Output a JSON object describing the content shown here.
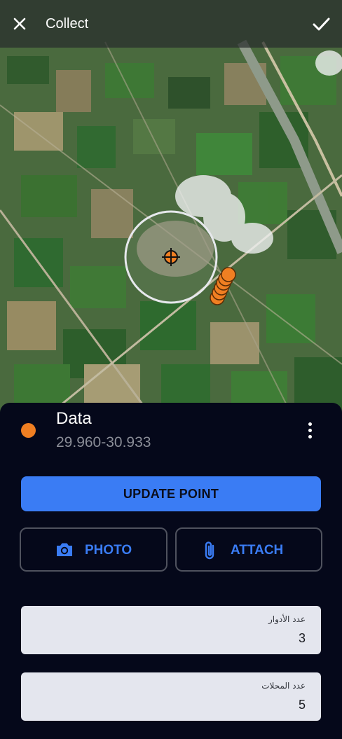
{
  "header": {
    "title": "Collect",
    "close_icon": "close-icon",
    "confirm_icon": "check-icon"
  },
  "map": {
    "marker_color": "#f07f22",
    "crosshair_icon": "crosshair-icon"
  },
  "layer": {
    "name": "Data",
    "subtitle": "29.960-30.933",
    "color": "#f07f22",
    "menu_icon": "more-vertical-icon"
  },
  "actions": {
    "update_label": "UPDATE POINT",
    "photo_label": "PHOTO",
    "photo_icon": "camera-icon",
    "attach_label": "ATTACH",
    "attach_icon": "paperclip-icon",
    "accent": "#3a7cf4"
  },
  "fields": [
    {
      "label": "عدد الأدوار",
      "value": "3"
    },
    {
      "label": "عدد المحلات",
      "value": "5"
    }
  ]
}
